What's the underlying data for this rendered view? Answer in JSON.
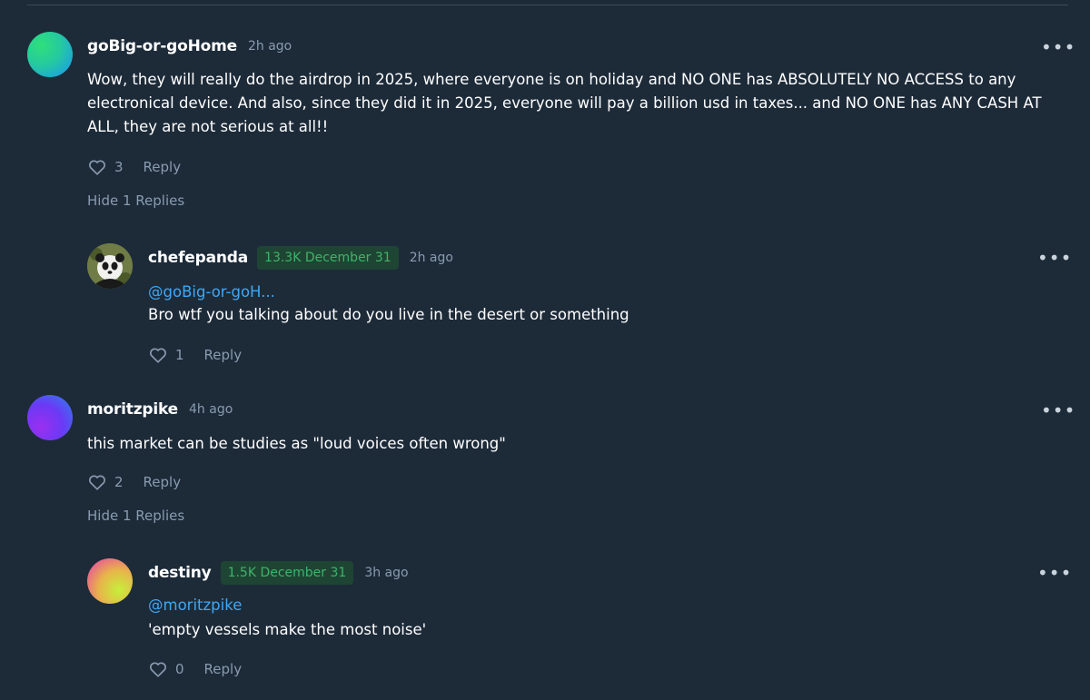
{
  "comments": [
    {
      "username": "goBig-or-goHome",
      "time": "2h ago",
      "text": "Wow, they will really do the airdrop in 2025, where everyone is on holiday and NO ONE has ABSOLUTELY NO ACCESS to any electronical device. And also, since they did it in 2025, everyone will pay a billion usd in taxes... and NO ONE has ANY CASH AT ALL, they are not serious at all!!",
      "likes": "3",
      "reply_label": "Reply",
      "hide_replies_label": "Hide 1 Replies",
      "more_label": "•••",
      "avatar_colors": [
        "#3be38a",
        "#1a9ee8"
      ],
      "reply": {
        "username": "chefepanda",
        "badge": "13.3K December 31",
        "time": "2h ago",
        "mention": "@goBig-or-goH...",
        "text": "Bro wtf you talking about do you live in the desert or something",
        "likes": "1",
        "reply_label": "Reply",
        "more_label": "•••",
        "avatar_icon": "panda-avatar"
      }
    },
    {
      "username": "moritzpike",
      "time": "4h ago",
      "text": "this market can be studies as \"loud voices often wrong\"",
      "likes": "2",
      "reply_label": "Reply",
      "hide_replies_label": "Hide 1 Replies",
      "more_label": "•••",
      "avatar_colors": [
        "#7b2ff7",
        "#3b6cf0"
      ],
      "reply": {
        "username": "destiny",
        "badge": "1.5K December 31",
        "time": "3h ago",
        "mention": "@moritzpike",
        "text": "'empty vessels make the most noise'",
        "likes": "0",
        "reply_label": "Reply",
        "more_label": "•••",
        "avatar_colors": [
          "#e84aa0",
          "#c6e63a"
        ]
      }
    }
  ],
  "colors": {
    "background": "#1d2b39",
    "muted_text": "#8a9bb0",
    "mention": "#3ea8f5",
    "badge_text": "#3fb36a",
    "badge_bg": "#1e4533"
  }
}
